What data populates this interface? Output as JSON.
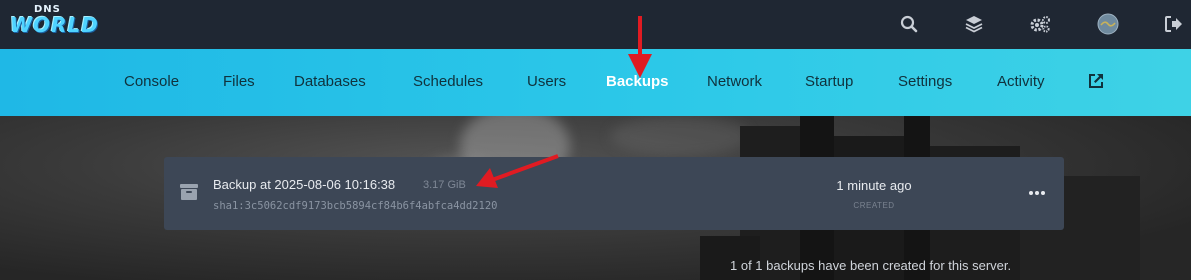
{
  "brand": {
    "logo_top": "DNS",
    "logo_bottom": "WORLD"
  },
  "top_icons": [
    "search-icon",
    "layers-icon",
    "cogs-icon",
    "avatar",
    "sign-out-icon"
  ],
  "nav": {
    "tabs": [
      {
        "label": "Console"
      },
      {
        "label": "Files"
      },
      {
        "label": "Databases"
      },
      {
        "label": "Schedules"
      },
      {
        "label": "Users"
      },
      {
        "label": "Backups"
      },
      {
        "label": "Network"
      },
      {
        "label": "Startup"
      },
      {
        "label": "Settings"
      },
      {
        "label": "Activity"
      }
    ],
    "active": "Backups"
  },
  "backup": {
    "name": "Backup at 2025-08-06 10:16:38",
    "size": "3.17 GiB",
    "hash": "sha1:3c5062cdf9173bcb5894cf84b6f4abfca4dd2120",
    "created_relative": "1 minute ago",
    "created_label": "CREATED"
  },
  "footer": {
    "note": "1 of 1 backups have been created for this server."
  },
  "colors": {
    "topbar": "#1f2733",
    "nav_accent": "#2cc8e8",
    "row_bg": "#3d4756",
    "annotation_arrow": "#e01b22"
  }
}
